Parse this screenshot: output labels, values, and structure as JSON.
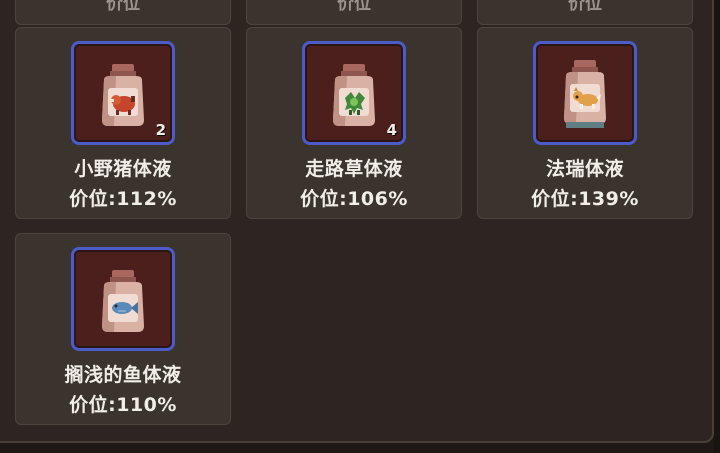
{
  "top_row_partial": [
    {
      "text": "价位"
    },
    {
      "text": "价位"
    },
    {
      "text": "价位"
    }
  ],
  "items": [
    {
      "name": "小野猪体液",
      "price_label": "价位:112%",
      "count": "2",
      "creature_icon": "boar-icon"
    },
    {
      "name": "走路草体液",
      "price_label": "价位:106%",
      "count": "4",
      "creature_icon": "walking-grass-icon"
    },
    {
      "name": "法瑞体液",
      "price_label": "价位:139%",
      "count": "",
      "creature_icon": "fox-dog-icon"
    },
    {
      "name": "搁浅的鱼体液",
      "price_label": "价位:110%",
      "count": "",
      "creature_icon": "fish-icon"
    }
  ],
  "colors": {
    "slot_border": "#4b5cc8",
    "slot_background": "#4a1f1c",
    "card_background": "#3a332e",
    "panel_background": "#2c2521",
    "text": "#f1ede8"
  }
}
